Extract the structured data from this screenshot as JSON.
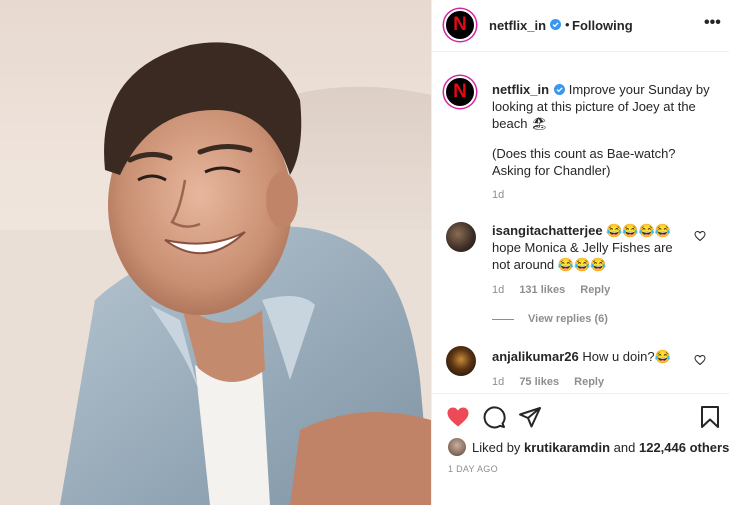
{
  "header": {
    "username": "netflix_in",
    "separator": "•",
    "follow_status": "Following",
    "more": "•••"
  },
  "caption": {
    "username": "netflix_in",
    "text": "Improve your Sunday by looking at this picture of Joey at the beach 🏖",
    "text2": "(Does this count as Bae-watch? Asking for Chandler)",
    "time": "1d"
  },
  "comments": [
    {
      "username": "isangitachatterjee",
      "text": "😂😂😂😂 hope Monica & Jelly Fishes are not around 😂😂😂",
      "time": "1d",
      "likes": "131 likes",
      "reply": "Reply"
    },
    {
      "username": "anjalikumar26",
      "text": "How u doin?😂",
      "time": "1d",
      "likes": "75 likes",
      "reply": "Reply"
    }
  ],
  "view_replies": "View replies (6)",
  "likes": {
    "prefix": "Liked by",
    "user": "krutikaramdin",
    "and": "and",
    "count": "122,446 others"
  },
  "posted": "1 DAY AGO",
  "icons": {
    "brand": "N",
    "verified": "verified-badge-icon",
    "like": "heart-filled-icon",
    "comment": "comment-bubble-icon",
    "share": "paper-plane-icon",
    "save": "bookmark-icon"
  },
  "colors": {
    "netflix_red": "#e50914",
    "verified_blue": "#3897f0",
    "like_red": "#ed4956",
    "muted": "#8e8e8e"
  }
}
